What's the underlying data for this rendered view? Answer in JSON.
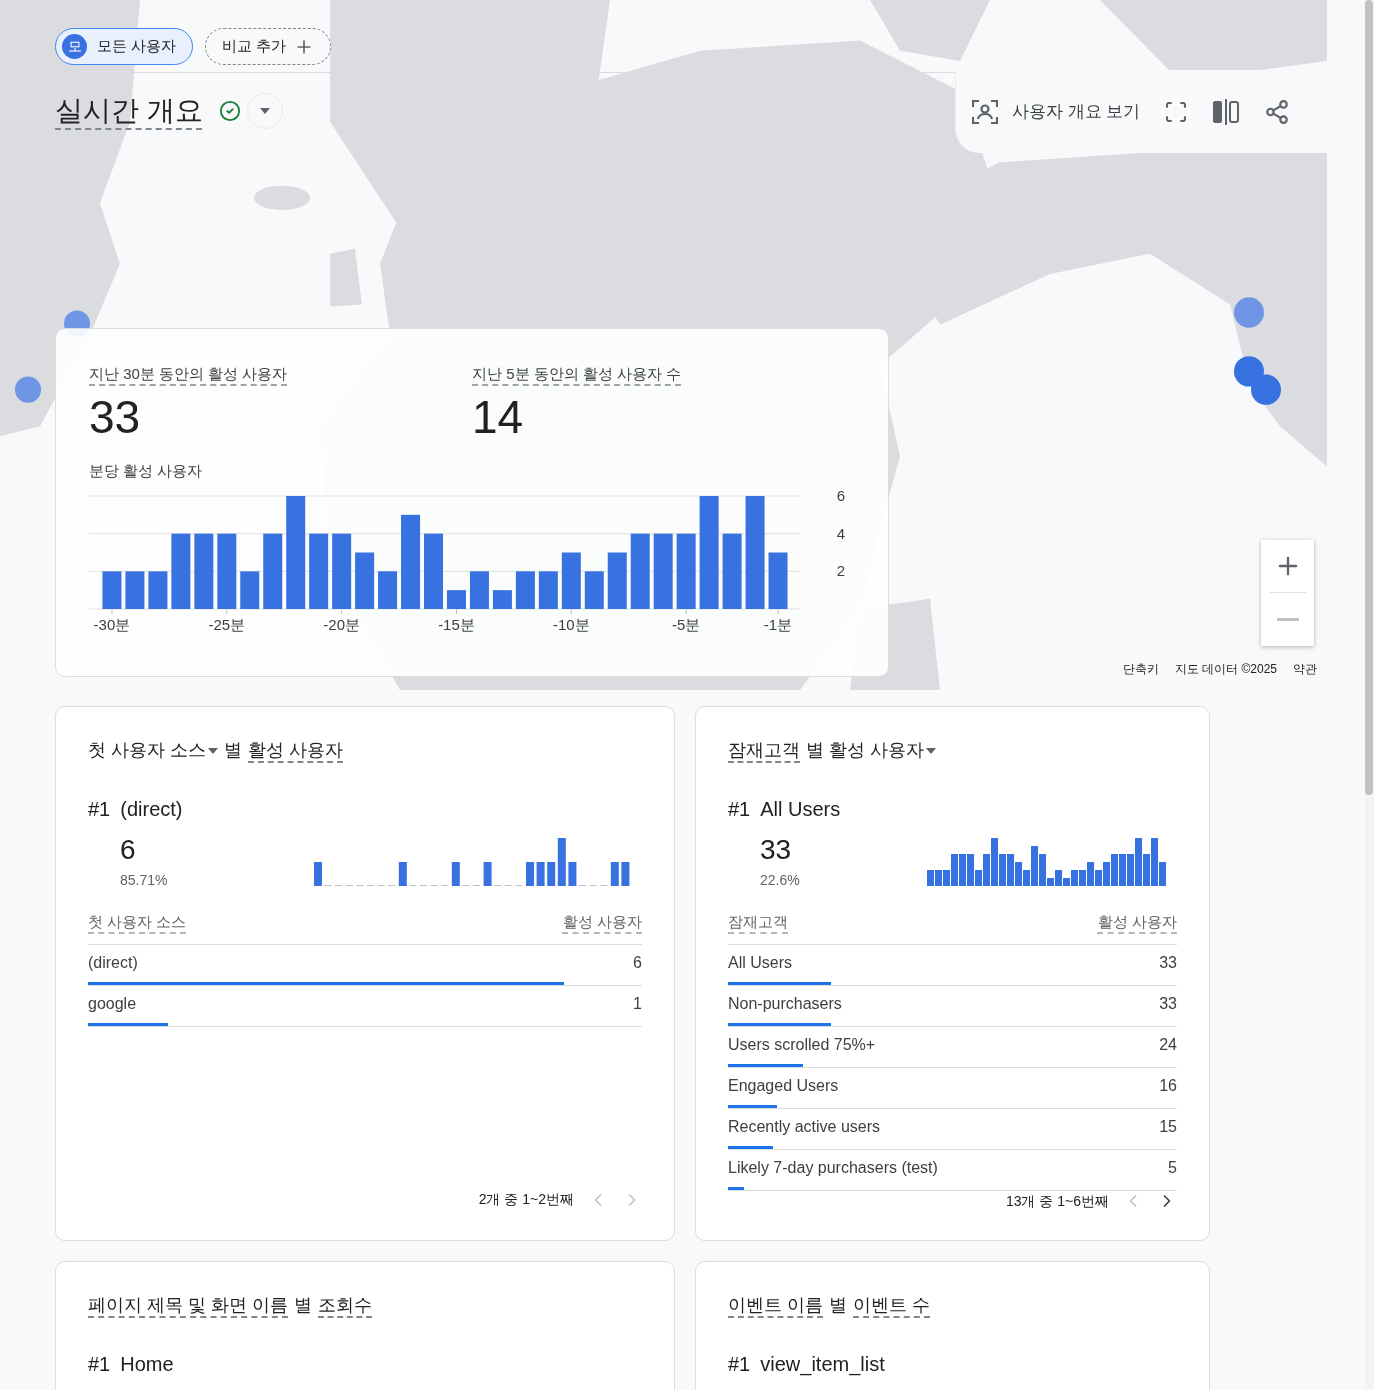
{
  "comparison_chips": [
    {
      "kind": "segment",
      "avatar": "모",
      "label": "모든 사용자"
    },
    {
      "kind": "add",
      "label": "비교 추가"
    }
  ],
  "page_title": "실시간 개요",
  "toolbar": {
    "view_user_overview": "사용자 개요 보기"
  },
  "map": {
    "footer": [
      "단축키",
      "지도 데이터 ©2025",
      "약관"
    ]
  },
  "realtime_card": {
    "metrics": [
      {
        "label": "지난 30분 동안의 활성 사용자",
        "value": "33"
      },
      {
        "label": "지난 5분 동안의 활성 사용자 수",
        "value": "14"
      }
    ],
    "chart_title": "분당 활성 사용자",
    "chart_data": {
      "type": "bar",
      "x": [
        -30,
        -29,
        -28,
        -27,
        -26,
        -25,
        -24,
        -23,
        -22,
        -21,
        -20,
        -19,
        -18,
        -17,
        -16,
        -15,
        -14,
        -13,
        -12,
        -11,
        -10,
        -9,
        -8,
        -7,
        -6,
        -5,
        -4,
        -3,
        -2,
        -1
      ],
      "values": [
        2,
        2,
        2,
        4,
        4,
        4,
        2,
        4,
        6,
        4,
        4,
        3,
        2,
        5,
        4,
        1,
        2,
        1,
        2,
        2,
        3,
        2,
        3,
        4,
        4,
        4,
        6,
        4,
        6,
        3
      ],
      "xlim": [
        -31,
        0
      ],
      "ylim": [
        0,
        6
      ],
      "yticks": [
        2,
        4,
        6
      ],
      "xticks": [
        {
          "value": -30,
          "label": "-30분"
        },
        {
          "value": -25,
          "label": "-25분"
        },
        {
          "value": -20,
          "label": "-20분"
        },
        {
          "value": -15,
          "label": "-15분"
        },
        {
          "value": -10,
          "label": "-10분"
        },
        {
          "value": -5,
          "label": "-5분"
        },
        {
          "value": -1,
          "label": "-1분"
        }
      ]
    }
  },
  "cards": [
    {
      "title": [
        {
          "kind": "dropdown",
          "text": "첫 사용자 소스"
        },
        {
          "kind": "plain",
          "text": "별"
        },
        {
          "kind": "dotted",
          "text": "활성 사용자"
        }
      ],
      "rank": "#1",
      "top_name": "(direct)",
      "top_value": "6",
      "top_share": "85.71%",
      "columns": [
        "첫 사용자 소스",
        "활성 사용자"
      ],
      "rows": [
        {
          "name": "(direct)",
          "value": "6",
          "level": 0.86
        },
        {
          "name": "google",
          "value": "1",
          "level": 0.145
        }
      ],
      "pagination": {
        "text": "2개 중 1~2번째",
        "prev_disabled": true,
        "next_disabled": true
      }
    },
    {
      "title": [
        {
          "kind": "dotted",
          "text": "잠재고객"
        },
        {
          "kind": "dropdown",
          "text": "별 활성 사용자"
        }
      ],
      "rank": "#1",
      "top_name": "All Users",
      "top_value": "33",
      "top_share": "22.6%",
      "columns": [
        "잠재고객",
        "활성 사용자"
      ],
      "rows": [
        {
          "name": "All Users",
          "value": "33",
          "level": 0.23
        },
        {
          "name": "Non-purchasers",
          "value": "33",
          "level": 0.23
        },
        {
          "name": "Users scrolled 75%+",
          "value": "24",
          "level": 0.166
        },
        {
          "name": "Engaged Users",
          "value": "16",
          "level": 0.11
        },
        {
          "name": "Recently active users",
          "value": "15",
          "level": 0.1
        },
        {
          "name": "Likely 7-day purchasers (test)",
          "value": "5",
          "level": 0.036
        }
      ],
      "pagination": {
        "text": "13개 중 1~6번째",
        "prev_disabled": true,
        "next_disabled": false
      }
    },
    {
      "title": [
        {
          "kind": "dotted",
          "text": "페이지 제목 및 화면 이름"
        },
        {
          "kind": "plain",
          "text": "별"
        },
        {
          "kind": "dotted",
          "text": "조회수"
        }
      ],
      "rank": "#1",
      "top_name": "Home"
    },
    {
      "title": [
        {
          "kind": "dotted",
          "text": "이벤트 이름"
        },
        {
          "kind": "plain",
          "text": "별"
        },
        {
          "kind": "dotted",
          "text": "이벤트 수"
        }
      ],
      "rank": "#1",
      "top_name": "view_item_list"
    }
  ]
}
